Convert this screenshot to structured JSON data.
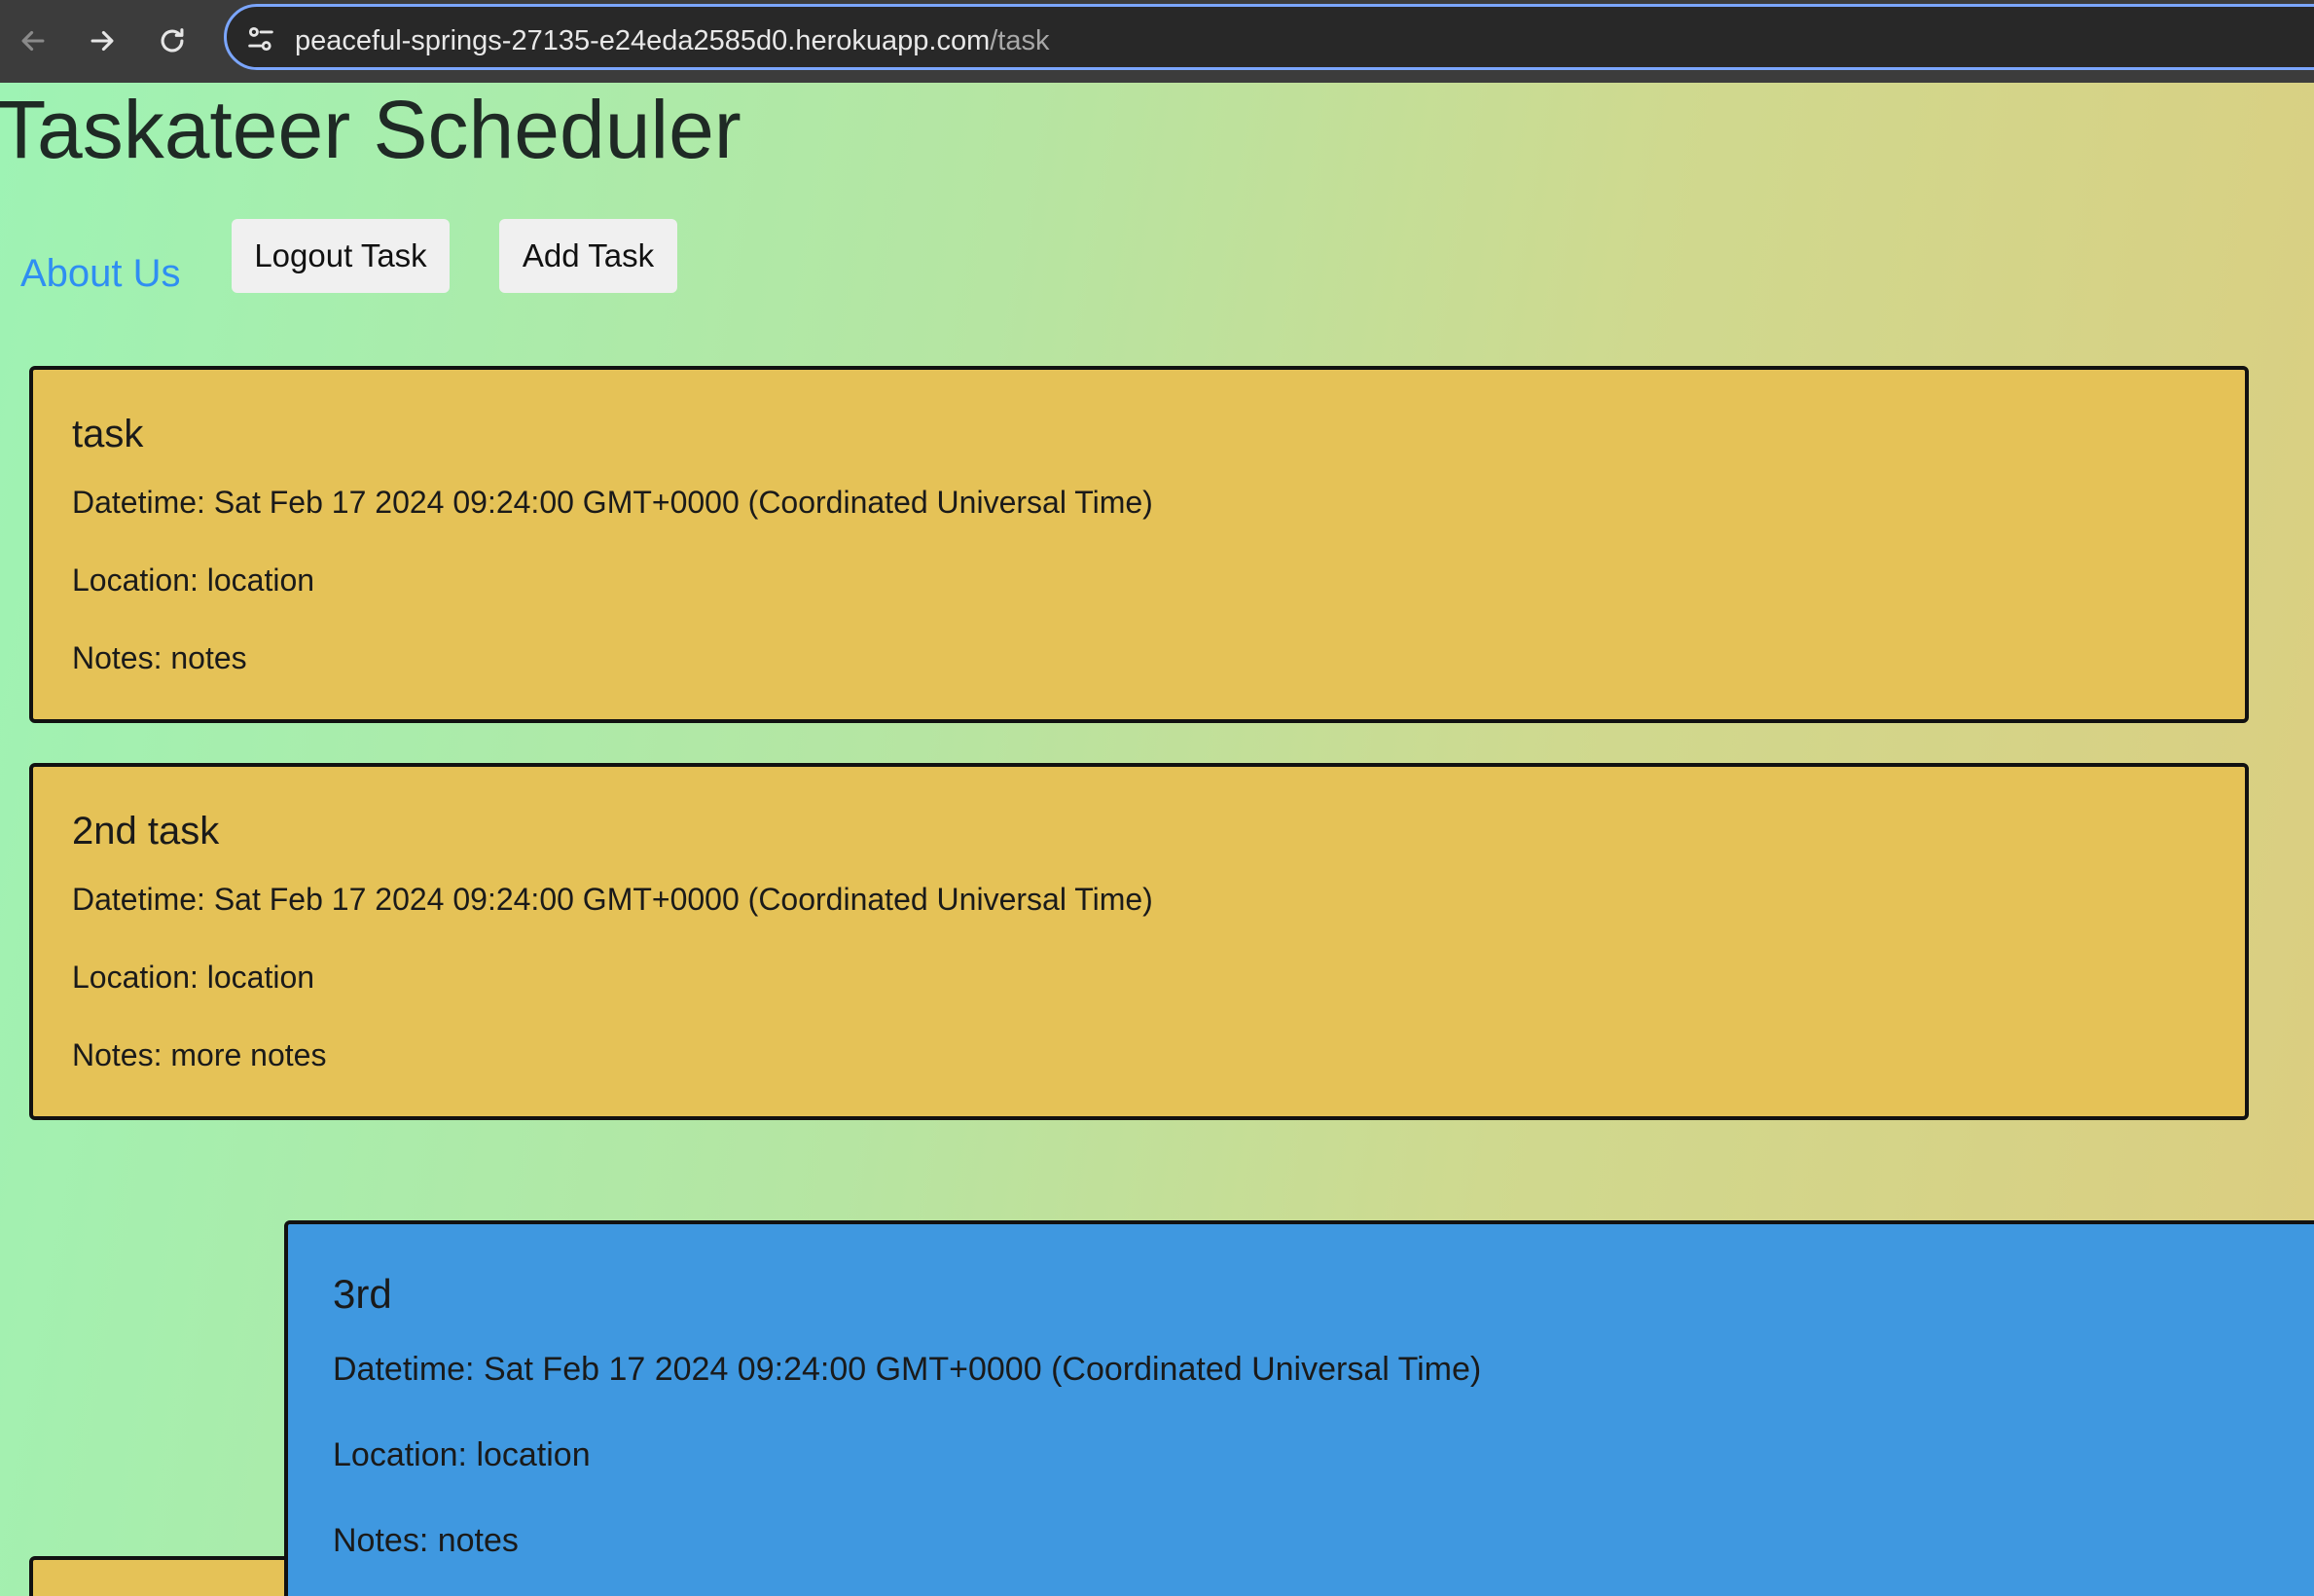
{
  "browser": {
    "url_host": "peaceful-springs-27135-e24eda2585d0.herokuapp.com",
    "url_path": "/task",
    "back_icon": "arrow-left-icon",
    "forward_icon": "arrow-right-icon",
    "reload_icon": "reload-icon",
    "site_info_icon": "tune-icon"
  },
  "header": {
    "title": "Taskateer Scheduler",
    "about_link": "About Us",
    "logout_button": "Logout Task",
    "add_button": "Add Task"
  },
  "tasks": [
    {
      "title": "task",
      "datetime": "Datetime: Sat Feb 17 2024 09:24:00 GMT+0000 (Coordinated Universal Time)",
      "location": "Location: location",
      "notes": "Notes: notes",
      "color": "#e5c257"
    },
    {
      "title": "2nd task",
      "datetime": "Datetime: Sat Feb 17 2024 09:24:00 GMT+0000 (Coordinated Universal Time)",
      "location": "Location: location",
      "notes": "Notes: more notes",
      "color": "#e5c257"
    },
    {
      "title": "3rd",
      "datetime": "Datetime: Sat Feb 17 2024 09:24:00 GMT+0000 (Coordinated Universal Time)",
      "location": "Location: location",
      "notes": "Notes: notes",
      "color": "#3f98e0"
    }
  ],
  "colors": {
    "link": "#2f8ef2",
    "card_yellow": "#e5c257",
    "card_blue": "#3f98e0",
    "omnibox_border": "#7ba6ff"
  }
}
